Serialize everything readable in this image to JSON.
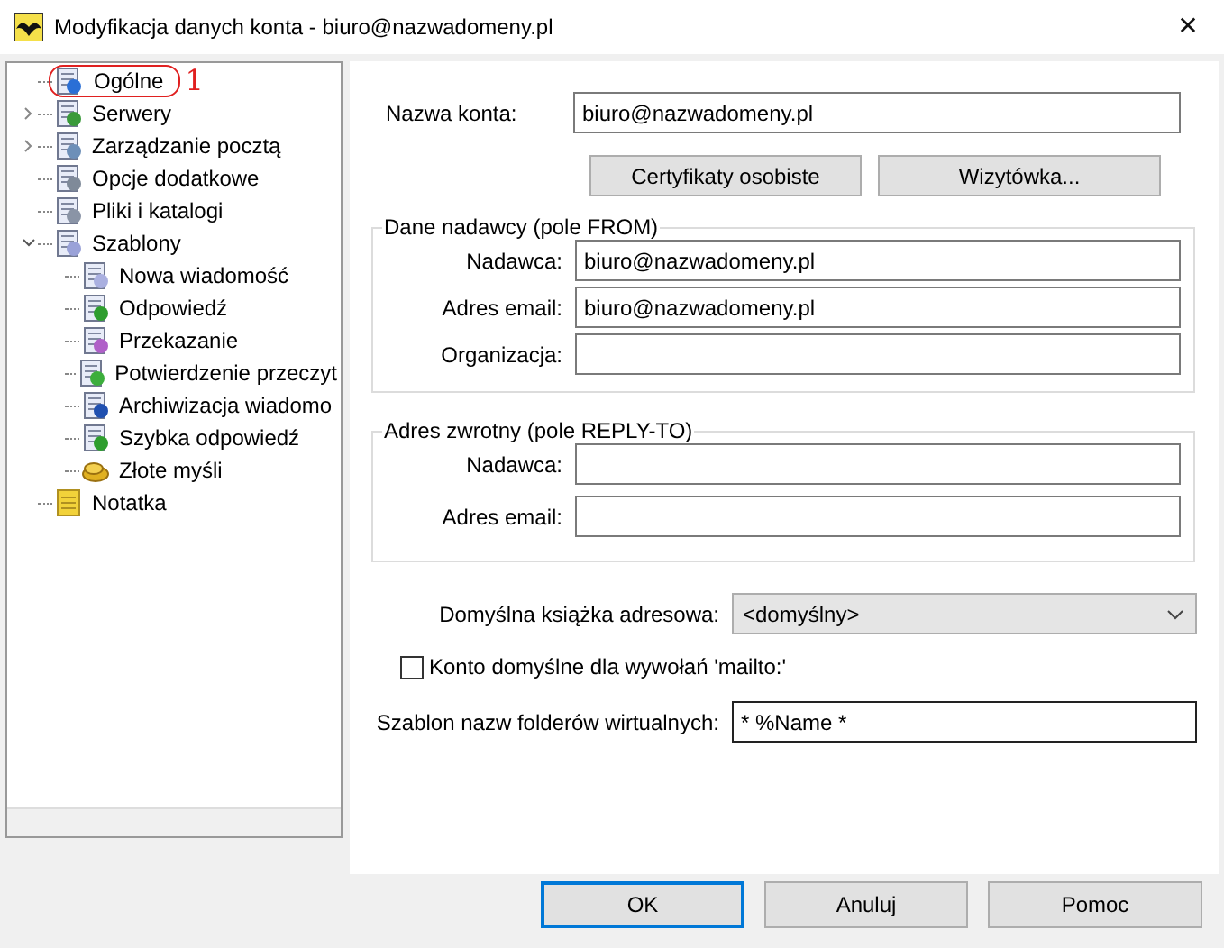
{
  "window": {
    "title": "Modyfikacja danych konta - biuro@nazwadomeny.pl",
    "close": "✕"
  },
  "tree": [
    {
      "label": "Ogólne",
      "kind": "account",
      "annotation": "1"
    },
    {
      "label": "Serwery",
      "kind": "servers",
      "expanded": false
    },
    {
      "label": "Zarządzanie pocztą",
      "kind": "mail",
      "expanded": false
    },
    {
      "label": "Opcje dodatkowe",
      "kind": "options"
    },
    {
      "label": "Pliki i katalogi",
      "kind": "files"
    },
    {
      "label": "Szablony",
      "kind": "templates",
      "expanded": true,
      "children": [
        {
          "label": "Nowa wiadomość",
          "kind": "doc"
        },
        {
          "label": "Odpowiedź",
          "kind": "reply"
        },
        {
          "label": "Przekazanie",
          "kind": "forward"
        },
        {
          "label": "Potwierdzenie przeczyt",
          "kind": "confirm"
        },
        {
          "label": "Archiwizacja wiadomo",
          "kind": "archive"
        },
        {
          "label": "Szybka odpowiedź",
          "kind": "reply"
        },
        {
          "label": "Złote myśli",
          "kind": "coins"
        }
      ]
    },
    {
      "label": "Notatka",
      "kind": "note"
    }
  ],
  "account_name": {
    "label": "Nazwa konta:",
    "value": "biuro@nazwadomeny.pl"
  },
  "buttons_top": [
    "Certyfikaty osobiste",
    "Wizytówka..."
  ],
  "groups": [
    {
      "title": "Dane nadawcy (pole FROM)",
      "fields": [
        {
          "label": "Nadawca:",
          "value": "biuro@nazwadomeny.pl"
        },
        {
          "label": "Adres email:",
          "value": "biuro@nazwadomeny.pl"
        },
        {
          "label": "Organizacja:"
        }
      ]
    },
    {
      "title": "Adres zwrotny (pole REPLY-TO)",
      "fields": [
        {
          "label": "Nadawca:"
        },
        {
          "label": "Adres email:"
        }
      ]
    }
  ],
  "address_book": {
    "label": "Domyślna książka adresowa:",
    "value": "<domyślny>"
  },
  "mailto_default": {
    "label": "Konto domyślne dla wywołań 'mailto:'",
    "checked": false
  },
  "folder_template": {
    "label": "Szablon nazw folderów wirtualnych:",
    "value": "* %Name *"
  },
  "dialog_buttons": [
    {
      "label": "OK",
      "selected": true
    },
    {
      "label": "Anuluj",
      "selected": false
    },
    {
      "label": "Pomoc",
      "selected": false
    }
  ]
}
